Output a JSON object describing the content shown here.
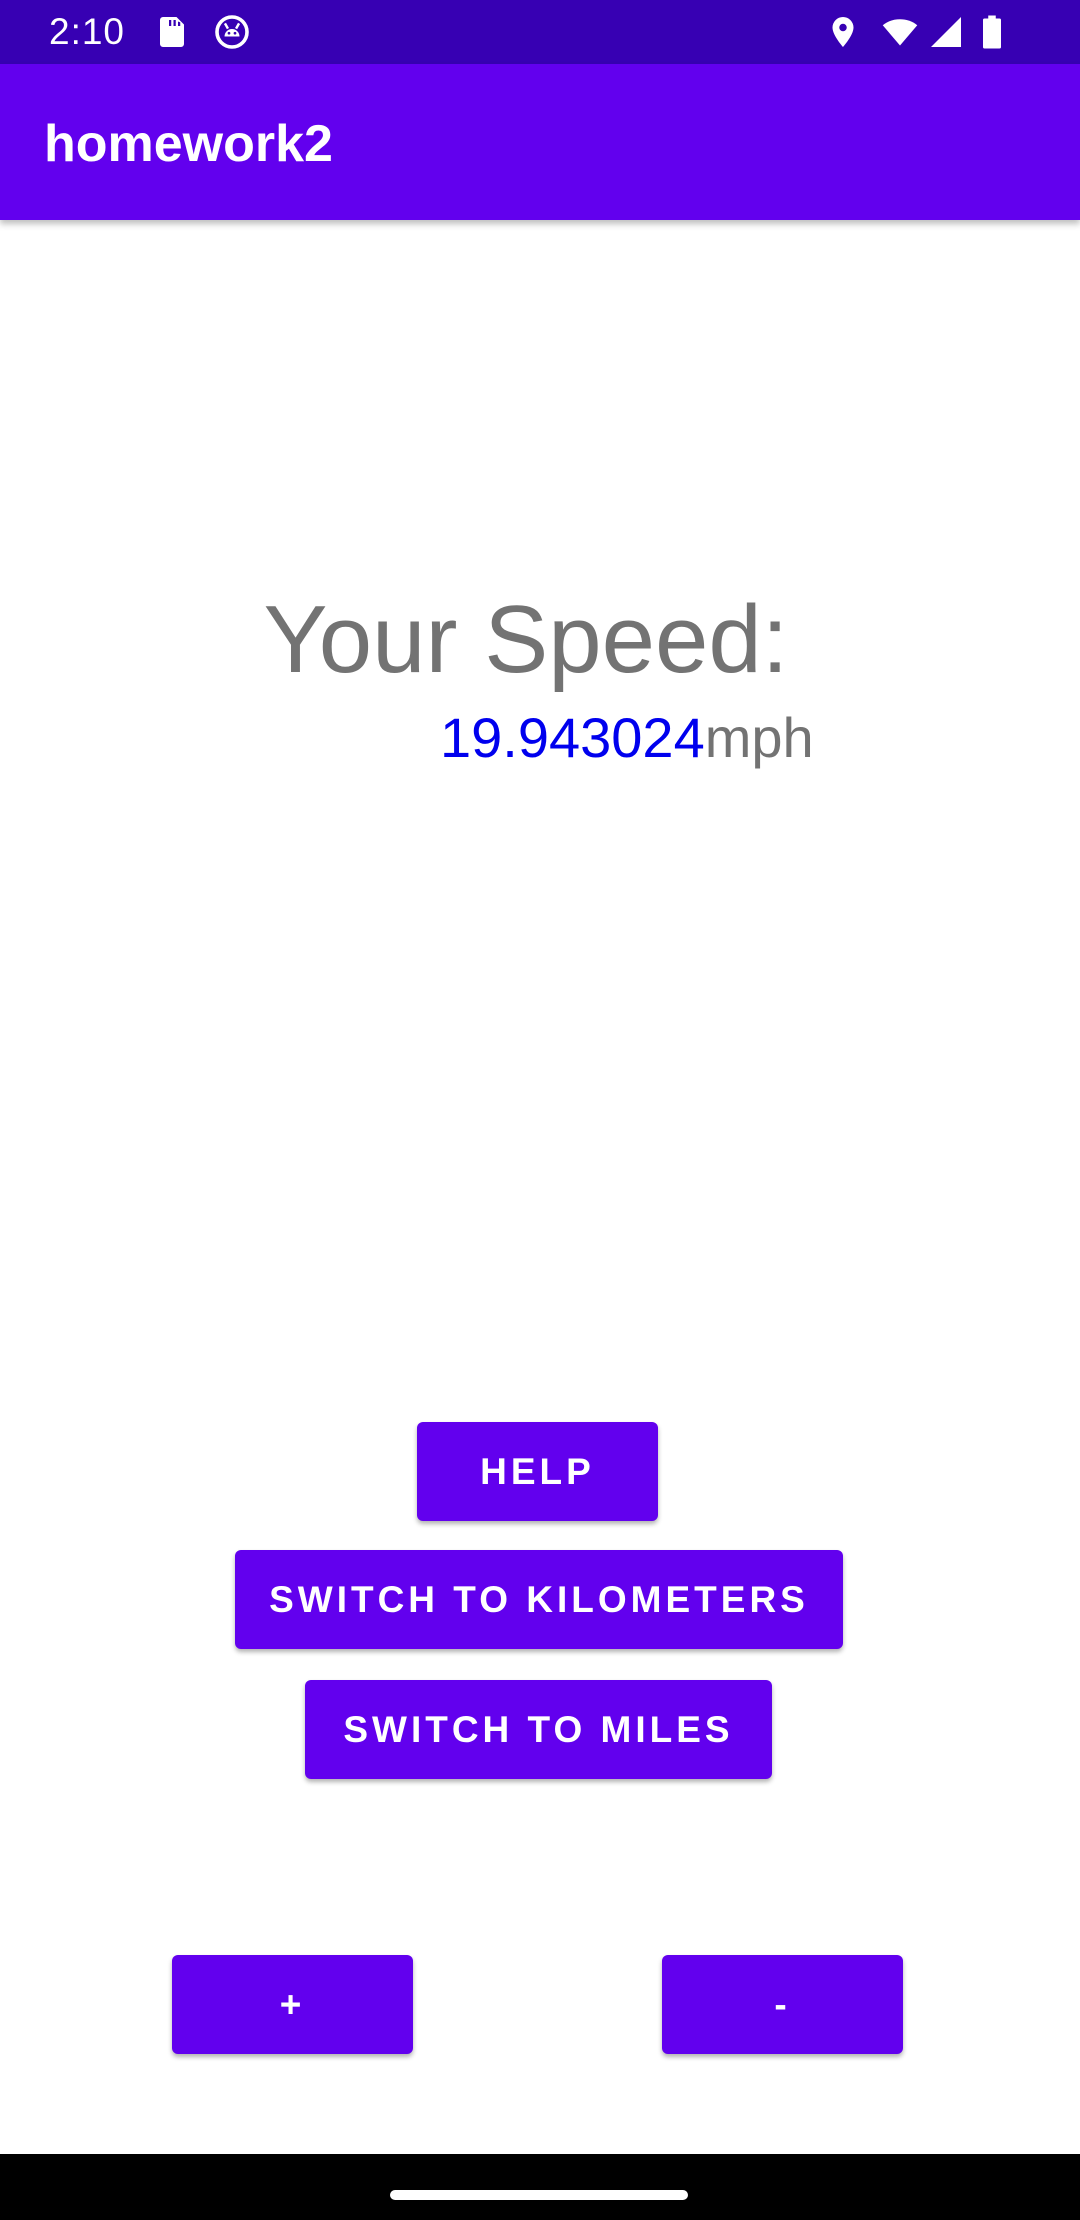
{
  "status_bar": {
    "time": "2:10",
    "left_icons": [
      "sd-card-icon",
      "android-debug-icon"
    ],
    "right_icons": [
      "location-icon",
      "wifi-icon",
      "signal-icon",
      "battery-icon"
    ]
  },
  "app_bar": {
    "title": "homework2"
  },
  "speed": {
    "heading": "Your Speed:",
    "value": "19.943024",
    "unit": "mph"
  },
  "buttons": {
    "help": "HELP",
    "switch_km": "SWITCH TO KILOMETERS",
    "switch_miles": "SWITCH TO MILES",
    "plus": "+",
    "minus": "-"
  },
  "colors": {
    "status_bar": "#3700B3",
    "primary": "#6200EE",
    "speed_value": "#0000EE",
    "secondary_text": "#737373"
  }
}
